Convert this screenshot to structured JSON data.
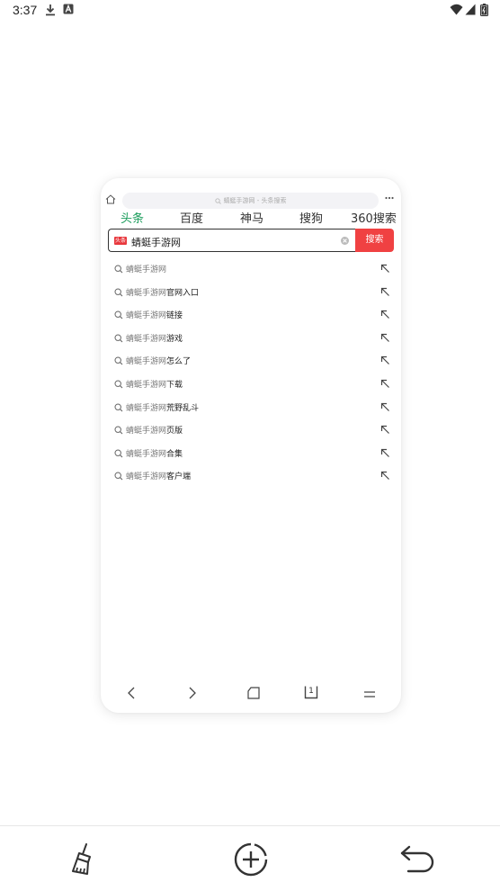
{
  "status_bar": {
    "time": "3:37",
    "icons": [
      "download-icon",
      "a-icon",
      "wifi-icon",
      "cellular-icon",
      "battery-icon"
    ]
  },
  "tab_card": {
    "url_placeholder": "蜻蜓手游网 - 头条搜索",
    "engine_tabs": [
      "头条",
      "百度",
      "神马",
      "搜狗",
      "360搜索"
    ],
    "active_engine": "头条",
    "search": {
      "logo_text": "头条",
      "query": "蜻蜓手游网",
      "button_label": "搜索"
    },
    "suggestions": [
      {
        "base": "蜻蜓手游网",
        "suffix": ""
      },
      {
        "base": "蜻蜓手游网",
        "suffix": "官网入口"
      },
      {
        "base": "蜻蜓手游网",
        "suffix": "链接"
      },
      {
        "base": "蜻蜓手游网",
        "suffix": "游戏"
      },
      {
        "base": "蜻蜓手游网",
        "suffix": "怎么了"
      },
      {
        "base": "蜻蜓手游网",
        "suffix": "下载"
      },
      {
        "base": "蜻蜓手游网",
        "suffix": "荒野乱斗"
      },
      {
        "base": "蜻蜓手游网",
        "suffix": "页版"
      },
      {
        "base": "蜻蜓手游网",
        "suffix": "合集"
      },
      {
        "base": "蜻蜓手游网",
        "suffix": "客户端"
      }
    ],
    "nav": {
      "tab_count": "1",
      "icons": [
        "back-icon",
        "forward-icon",
        "home-icon",
        "tabs-icon",
        "menu-icon"
      ]
    }
  },
  "bottom_bar": {
    "icons": [
      "clean-brush-icon",
      "new-tab-icon",
      "return-icon"
    ]
  },
  "colors": {
    "accent_red": "#f04142",
    "active_tab_green": "#1a9c5b"
  }
}
